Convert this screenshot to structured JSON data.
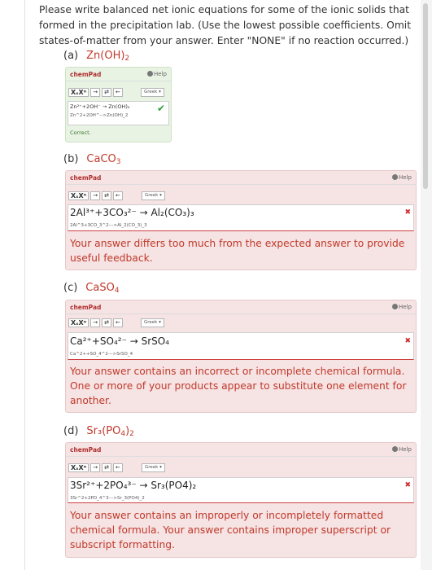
{
  "intro_text": "Please write balanced net ionic equations for some of the ionic solids that formed in the precipitation lab. (Use the lowest possible coefficients. Omit states-of-matter from your answer. Enter \"NONE\" if no reaction occurred.)",
  "chempad": {
    "title": "chemPad",
    "help_label": "Help",
    "toolbar": [
      "XₓXⁿ",
      "→",
      "⇄",
      "←"
    ],
    "greek_label": "Greek ▾"
  },
  "parts": [
    {
      "letter": "(a)",
      "formula_main": "Zn(OH)",
      "formula_sub": "2",
      "answer_display": "Zn²⁺+2OH⁻ → Zn(OH)₂",
      "answer_raw": "Zn^2+2OH^-->Zn(OH)_2",
      "status": "correct",
      "feedback": "Correct."
    },
    {
      "letter": "(b)",
      "formula_main": "CaCO",
      "formula_sub": "3",
      "answer_display": "2Al³⁺+3CO₃²⁻ → Al₂(CO₃)₃",
      "answer_raw": "2Al^3+3CO_3^2--->Al_2(CO_3)_3",
      "status": "incorrect",
      "feedback": "Your answer differs too much from the expected answer to provide useful feedback."
    },
    {
      "letter": "(c)",
      "formula_main": "CaSO",
      "formula_sub": "4",
      "answer_display": "Ca²⁺+SO₄²⁻ → SrSO₄",
      "answer_raw": "Ca^2++SO_4^2--->SrSO_4",
      "status": "incorrect",
      "feedback": "Your answer contains an incorrect or incomplete chemical formula. One or more of your products appear to substitute one element for another."
    },
    {
      "letter": "(d)",
      "formula_main": "Sr₃(PO",
      "formula_sub": "4",
      "formula_tail": ")",
      "formula_tail_sub": "2",
      "answer_display": "3Sr²⁺+2PO₄³⁻ → Sr₃(PO4)₂",
      "answer_raw": "3Sr^2+2PO_4^3--->Sr_3(PO4)_2",
      "status": "incorrect",
      "feedback": "Your answer contains an improperly or incompletely formatted chemical formula. Your answer contains improper superscript or subscript formatting."
    }
  ],
  "colors": {
    "accent_red": "#c0392b",
    "correct_bg": "#e8f3e3",
    "incorrect_bg": "#f6e3e3",
    "check_green": "#2e9e3e"
  }
}
